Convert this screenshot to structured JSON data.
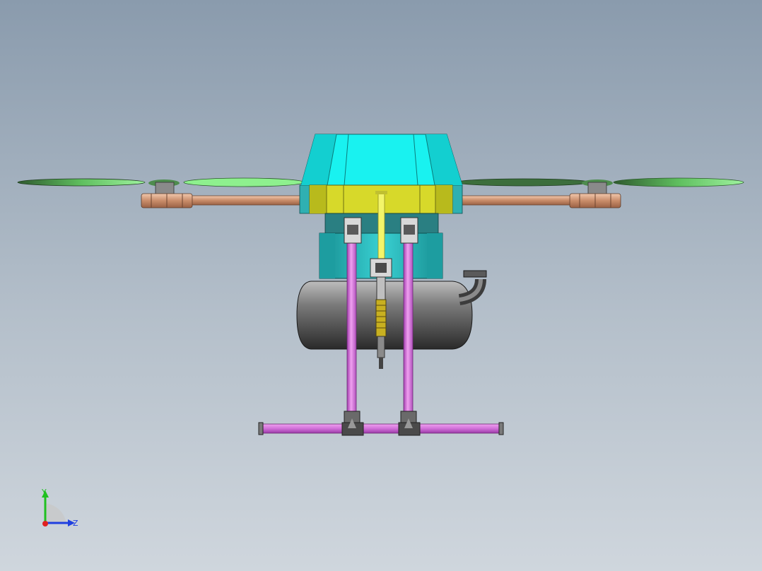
{
  "viewport": {
    "background_top": "#8a9bad",
    "background_bottom": "#cfd6dd"
  },
  "model": {
    "colors": {
      "body_top": "#19f2f0",
      "body_band": "#d7d92a",
      "bracket": "#2ab9bc",
      "arm": "#d69c7d",
      "propeller": "#7fe07f",
      "landing_gear": "#d37ad6",
      "tank": "#4a4a4a",
      "probe": "#e9f06a"
    }
  },
  "triad": {
    "y_label": "Y",
    "z_label": "Z",
    "y_color": "#20c020",
    "z_color": "#2040e0",
    "x_color": "#e02020"
  }
}
